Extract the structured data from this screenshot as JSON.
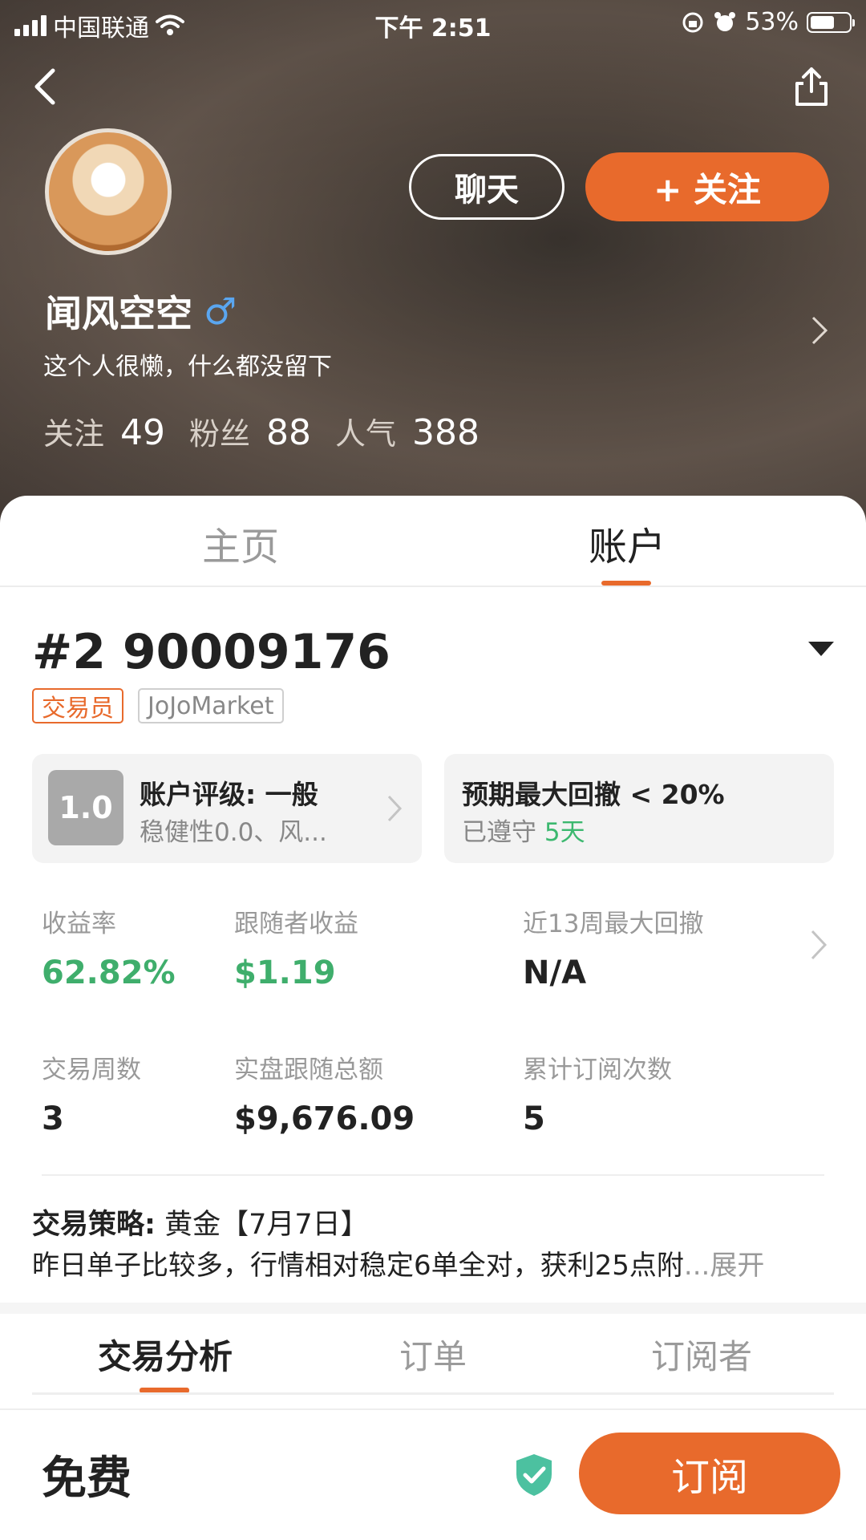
{
  "status_bar": {
    "carrier": "中国联通",
    "time": "下午 2:51",
    "battery": "53%"
  },
  "profile": {
    "name": "闻风空空",
    "gender_symbol": "♂",
    "bio": "这个人很懒，什么都没留下",
    "chat_label": "聊天",
    "follow_label": "+ 关注",
    "stats": [
      {
        "label": "关注",
        "value": "49"
      },
      {
        "label": "粉丝",
        "value": "88"
      },
      {
        "label": "人气",
        "value": "388"
      }
    ]
  },
  "top_tabs": [
    "主页",
    "账户"
  ],
  "account": {
    "id": "#2 90009176",
    "badges": [
      "交易员",
      "JoJoMarket"
    ],
    "rating_score": "1.0",
    "rating_title": "账户评级: 一般",
    "rating_sub": "稳健性0.0、风...",
    "drawdown_title": "预期最大回撤 < 20%",
    "drawdown_kept_label": "已遵守",
    "drawdown_kept_days": "5天"
  },
  "metrics": [
    {
      "label": "收益率",
      "value": "62.82%"
    },
    {
      "label": "跟随者收益",
      "value": "$1.19"
    },
    {
      "label": "近13周最大回撤",
      "value": "N/A"
    },
    {
      "label": "交易周数",
      "value": "3"
    },
    {
      "label": "实盘跟随总额",
      "value": "$9,676.09"
    },
    {
      "label": "累计订阅次数",
      "value": "5"
    }
  ],
  "strategy": {
    "label": "交易策略:",
    "title": "黄金【7月7日】",
    "text": "昨日单子比较多，行情相对稳定6单全对，获利25点附",
    "ellipsis": "...",
    "expand": "展开"
  },
  "sub_tabs": [
    "交易分析",
    "订单",
    "订阅者"
  ],
  "bottom_bar": {
    "price": "免费",
    "subscribe_label": "订阅"
  },
  "colors": {
    "accent": "#e86a2c",
    "positive": "#3fae6c",
    "shield": "#4cc1a0"
  }
}
